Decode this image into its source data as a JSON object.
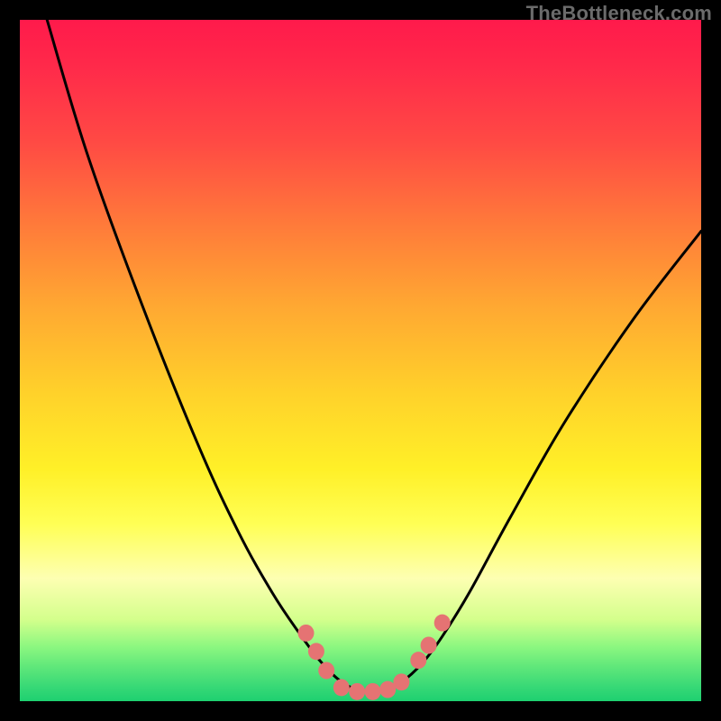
{
  "watermark": "TheBottleneck.com",
  "colors": {
    "frame": "#000000",
    "curve": "#000000",
    "marker_fill": "#e57373",
    "marker_stroke": "#e57373"
  },
  "chart_data": {
    "type": "line",
    "title": "",
    "xlabel": "",
    "ylabel": "",
    "xlim": [
      0,
      100
    ],
    "ylim": [
      0,
      100
    ],
    "note": "No axis tick labels visible; x/y are percent across the plot area. y=0 is top, y=100 is bottom (bottleneck % decreases toward bottom/green).",
    "series": [
      {
        "name": "bottleneck-curve",
        "points": [
          {
            "x": 4.0,
            "y": 0.0
          },
          {
            "x": 10.0,
            "y": 20.0
          },
          {
            "x": 18.0,
            "y": 42.0
          },
          {
            "x": 26.0,
            "y": 62.0
          },
          {
            "x": 32.0,
            "y": 75.0
          },
          {
            "x": 37.0,
            "y": 84.0
          },
          {
            "x": 41.0,
            "y": 90.0
          },
          {
            "x": 44.0,
            "y": 94.0
          },
          {
            "x": 47.0,
            "y": 97.0
          },
          {
            "x": 50.0,
            "y": 98.5
          },
          {
            "x": 53.0,
            "y": 98.6
          },
          {
            "x": 56.0,
            "y": 97.2
          },
          {
            "x": 59.0,
            "y": 94.5
          },
          {
            "x": 62.0,
            "y": 90.5
          },
          {
            "x": 66.0,
            "y": 84.0
          },
          {
            "x": 72.0,
            "y": 73.0
          },
          {
            "x": 80.0,
            "y": 59.0
          },
          {
            "x": 90.0,
            "y": 44.0
          },
          {
            "x": 100.0,
            "y": 31.0
          }
        ]
      }
    ],
    "markers": [
      {
        "x": 42.0,
        "y": 90.0
      },
      {
        "x": 43.5,
        "y": 92.7
      },
      {
        "x": 45.0,
        "y": 95.5
      },
      {
        "x": 47.2,
        "y": 98.0
      },
      {
        "x": 49.5,
        "y": 98.6
      },
      {
        "x": 51.8,
        "y": 98.6
      },
      {
        "x": 54.0,
        "y": 98.3
      },
      {
        "x": 56.0,
        "y": 97.2
      },
      {
        "x": 58.5,
        "y": 94.0
      },
      {
        "x": 60.0,
        "y": 91.8
      },
      {
        "x": 62.0,
        "y": 88.5
      }
    ],
    "marker_radius_px": 9
  }
}
